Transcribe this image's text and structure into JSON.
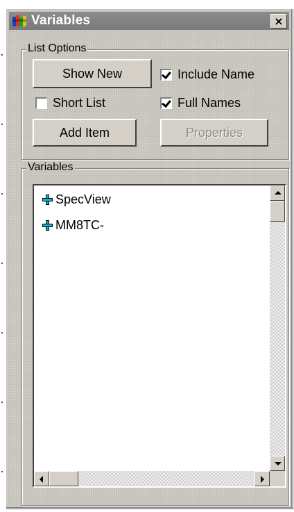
{
  "window": {
    "title": "Variables",
    "close_glyph": "×"
  },
  "list_options": {
    "label": "List Options",
    "show_new_label": "Show New",
    "include_name_label": "Include Name",
    "include_name_checked": true,
    "short_list_label": "Short List",
    "short_list_checked": false,
    "full_names_label": "Full Names",
    "full_names_checked": true,
    "add_item_label": "Add Item",
    "properties_label": "Properties",
    "properties_enabled": false
  },
  "variables": {
    "label": "Variables",
    "items": [
      {
        "label": "SpecView",
        "icon": "plus-expand-icon"
      },
      {
        "label": "MM8TC-",
        "icon": "plus-expand-icon"
      }
    ]
  },
  "colors": {
    "window_face": "#c8c5bd",
    "titlebar_inactive": "#808080",
    "expand_icon": "#19b2c9"
  }
}
